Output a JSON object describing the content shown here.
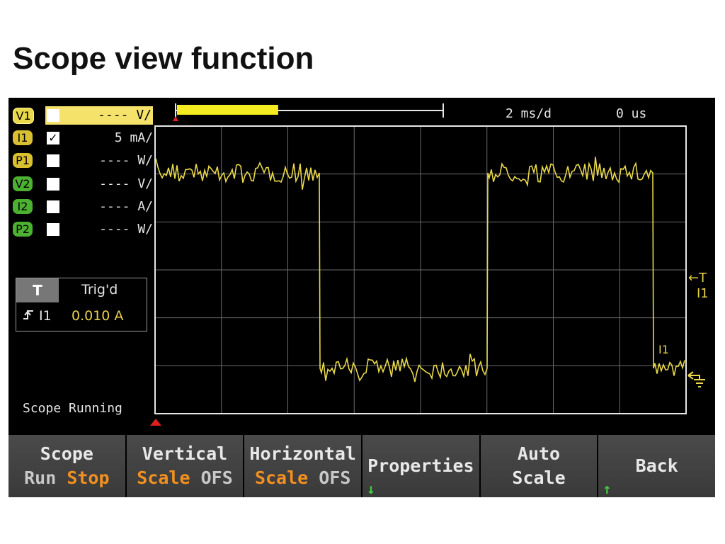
{
  "slide": {
    "title": "Scope view function"
  },
  "channels": [
    {
      "id": "V1",
      "label": "V1",
      "checked": false,
      "scale": "---- V/"
    },
    {
      "id": "I1",
      "label": "I1",
      "checked": true,
      "scale": "5 mA/"
    },
    {
      "id": "P1",
      "label": "P1",
      "checked": false,
      "scale": "---- W/"
    },
    {
      "id": "V2",
      "label": "V2",
      "checked": false,
      "scale": "---- V/"
    },
    {
      "id": "I2",
      "label": "I2",
      "checked": false,
      "scale": "---- A/"
    },
    {
      "id": "P2",
      "label": "P2",
      "checked": false,
      "scale": "---- W/"
    }
  ],
  "check_mark": "✓",
  "trigger": {
    "tab": "T",
    "state": "Trig'd",
    "slope_icon": "rising-edge-icon",
    "source": "I1",
    "level": "0.010 A"
  },
  "status": "Scope Running",
  "timebase": "2 ms/d",
  "offset": "0 us",
  "trigger_marker": {
    "arrow": "←T",
    "source": "I1"
  },
  "trace_label": "I1",
  "colors": {
    "trace": "#e8d84a",
    "grid": "#6a6a6a",
    "accent_orange": "#f29020",
    "softkey_bg": "#404040",
    "arrow_green": "#3ecf3e"
  },
  "record_bar": {
    "fill_fraction": 0.38
  },
  "softkeys": [
    {
      "id": "scope",
      "line1": "Scope",
      "line2_a": "Run",
      "line2_b": "Stop"
    },
    {
      "id": "vertical",
      "line1": "Vertical",
      "line2_a": "Scale",
      "line2_b": "OFS"
    },
    {
      "id": "horizontal",
      "line1": "Horizontal",
      "line2_a": "Scale",
      "line2_b": "OFS"
    },
    {
      "id": "properties",
      "line1": "Properties",
      "arrow": "↓"
    },
    {
      "id": "autoscale",
      "line1": "Auto",
      "line2": "Scale"
    },
    {
      "id": "back",
      "line1": "Back",
      "arrow": "↑"
    }
  ]
}
